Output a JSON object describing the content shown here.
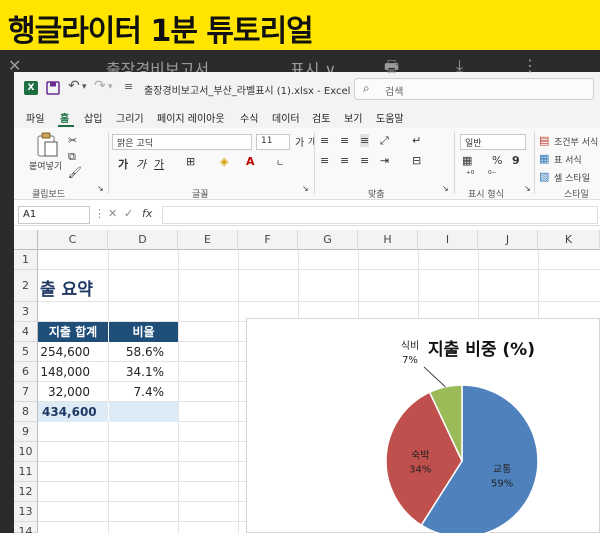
{
  "banner": {
    "title": "행글라이터 1분 튜토리얼"
  },
  "background_app": {
    "items": [
      "✕",
      "출장경비보고서",
      "표시 ∨"
    ],
    "icons": [
      "close-icon",
      "printer-icon",
      "download-icon",
      "more-icon"
    ]
  },
  "window": {
    "doc_title": "출장경비보고서_부산_라벨표시 (1).xlsx  -  Excel",
    "search_placeholder": "검색"
  },
  "menu": {
    "items": [
      "파일",
      "홈",
      "삽입",
      "그리기",
      "페이지 레이아웃",
      "수식",
      "데이터",
      "검토",
      "보기",
      "도움말"
    ],
    "active": "홈"
  },
  "ribbon": {
    "clipboard": {
      "paste": "붙여넣기",
      "group": "클립보드"
    },
    "font": {
      "name": "맑은 고딕",
      "size": "11",
      "bold": "가",
      "italic": "가",
      "underline": "가",
      "grow": "가",
      "shrink": "가",
      "group": "글꼴"
    },
    "alignment": {
      "group": "맞춤"
    },
    "number": {
      "format": "일반",
      "percent": "%",
      "comma": "9",
      "group": "표시 형식"
    },
    "styles": {
      "conditional": "조건부 서식",
      "table": "표 서식",
      "cell": "셀 스타일",
      "group": "스타일"
    }
  },
  "formula_bar": {
    "cell_ref": "A1",
    "fx": "fx"
  },
  "grid": {
    "columns": [
      "C",
      "D",
      "E",
      "F",
      "G",
      "H",
      "I",
      "J",
      "K"
    ],
    "rows": [
      "1",
      "2",
      "3",
      "4",
      "5",
      "6",
      "7",
      "8",
      "9",
      "10",
      "11",
      "12",
      "13",
      "14"
    ],
    "sheet_title": "출 요약",
    "headers": {
      "total": "지출 합계",
      "ratio": "비율"
    },
    "data": [
      {
        "total": "254,600",
        "ratio": "58.6%"
      },
      {
        "total": "148,000",
        "ratio": "34.1%"
      },
      {
        "total": "32,000",
        "ratio": "7.4%"
      }
    ],
    "grand_total": "434,600"
  },
  "chart_data": {
    "type": "pie",
    "title": "지출 비중 (%)",
    "labels": [
      "교통",
      "숙박",
      "식비"
    ],
    "values": [
      59,
      34,
      7
    ],
    "value_labels": [
      "59%",
      "34%",
      "7%"
    ],
    "colors": [
      "#4f81bd",
      "#c0504d",
      "#9bbb59"
    ],
    "legend": "none"
  }
}
